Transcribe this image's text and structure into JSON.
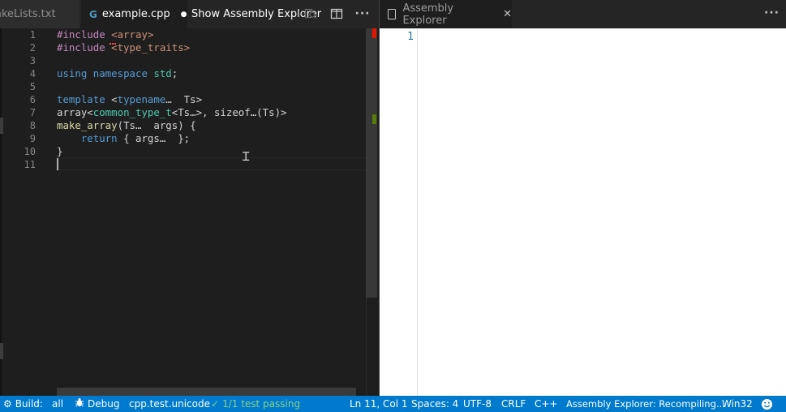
{
  "left_tabs": {
    "inactive_tab": "akeLists.txt",
    "active_tab": "example.cpp",
    "active_icon_glyph": "G",
    "dirty_dot": "●",
    "show_assembly_explorer": "Show Assembly Explorer"
  },
  "left_editor": {
    "line_numbers": [
      "1",
      "2",
      "3",
      "4",
      "5",
      "6",
      "7",
      "8",
      "9",
      "10",
      "11"
    ]
  },
  "right_tabs": {
    "assembly_tab": "Assembly Explorer",
    "close_glyph": "✕"
  },
  "right_editor": {
    "line_number": "1"
  },
  "statusbar": {
    "build": "Build:",
    "build_target": "all",
    "debug": "Debug",
    "config": "cpp.test.unicode",
    "tests": "1/1 test passing",
    "position": "Ln 11, Col 1",
    "spaces": "Spaces: 4",
    "encoding": "UTF-8",
    "eol": "CRLF",
    "language": "C++",
    "asm_status": "Assembly Explorer: Recompiling...",
    "platform": "Win32"
  },
  "icons": {
    "more_actions": "ellipsis-icon",
    "split": "split-editor-icon",
    "search": "assembly-search-icon",
    "gear": "gear-icon",
    "bug": "bug-icon",
    "check": "check-icon",
    "smiley": "feedback-smiley-icon",
    "file": "file-icon"
  },
  "colors": {
    "statusbar": "#007acc",
    "keyword": "#569cd6",
    "preprocessor": "#c586c0",
    "string": "#ce9178",
    "type": "#4ec9b0",
    "function": "#dcdcaa",
    "test_pass": "#89d185"
  }
}
